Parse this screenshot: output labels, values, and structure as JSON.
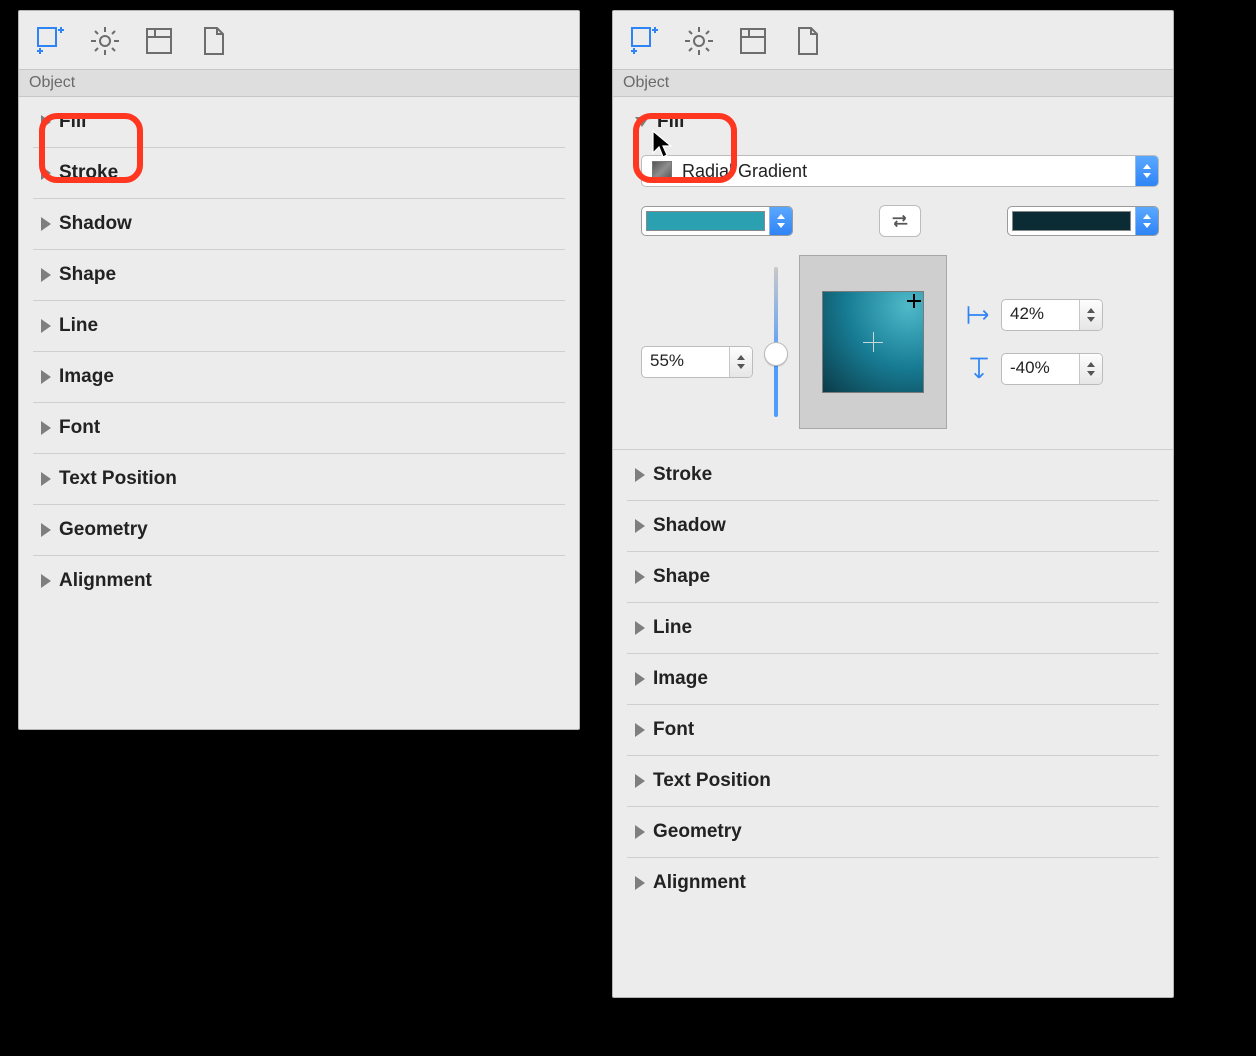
{
  "section_header": "Object",
  "toolbar": {
    "icons": [
      "layout",
      "gear",
      "columns",
      "page"
    ]
  },
  "rows": {
    "fill": "Fill",
    "stroke": "Stroke",
    "shadow": "Shadow",
    "shape": "Shape",
    "line": "Line",
    "image": "Image",
    "font": "Font",
    "text_position": "Text Position",
    "geometry": "Geometry",
    "alignment": "Alignment"
  },
  "fill_panel": {
    "type_label": "Radial Gradient",
    "color1": "#2aa0b0",
    "color2": "#0b2c34",
    "blend_value": "55%",
    "offset_x": "42%",
    "offset_y": "-40%"
  }
}
